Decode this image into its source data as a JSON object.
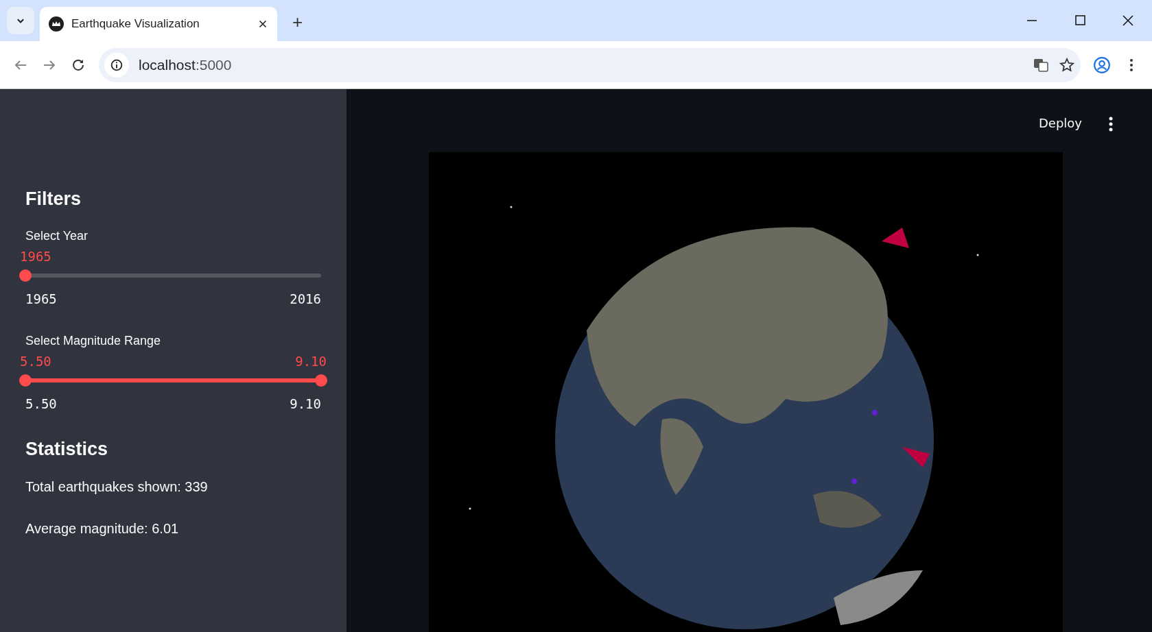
{
  "browser": {
    "tabs": [
      {
        "title": "Earthquake Visualization",
        "selected": true
      }
    ],
    "new_tab": "+",
    "address": {
      "host": "localhost",
      "port": ":5000"
    }
  },
  "sidebar": {
    "heading": "Filters",
    "year_slider": {
      "label": "Select Year",
      "value": "1965",
      "level": 0,
      "min": "1965",
      "max": "2016"
    },
    "magnitude_slider": {
      "label": "Select Magnitude Range",
      "thumbs": [
        {
          "value": "5.50",
          "level": 0
        },
        {
          "value": "9.10",
          "level": 1
        }
      ],
      "min": "5.50",
      "max": "9.10"
    },
    "stats_heading": "Statistics",
    "stats": [
      "Total earthquakes shown: 339",
      "Average magnitude: 6.01"
    ]
  },
  "main": {
    "deploy": "Deploy"
  }
}
